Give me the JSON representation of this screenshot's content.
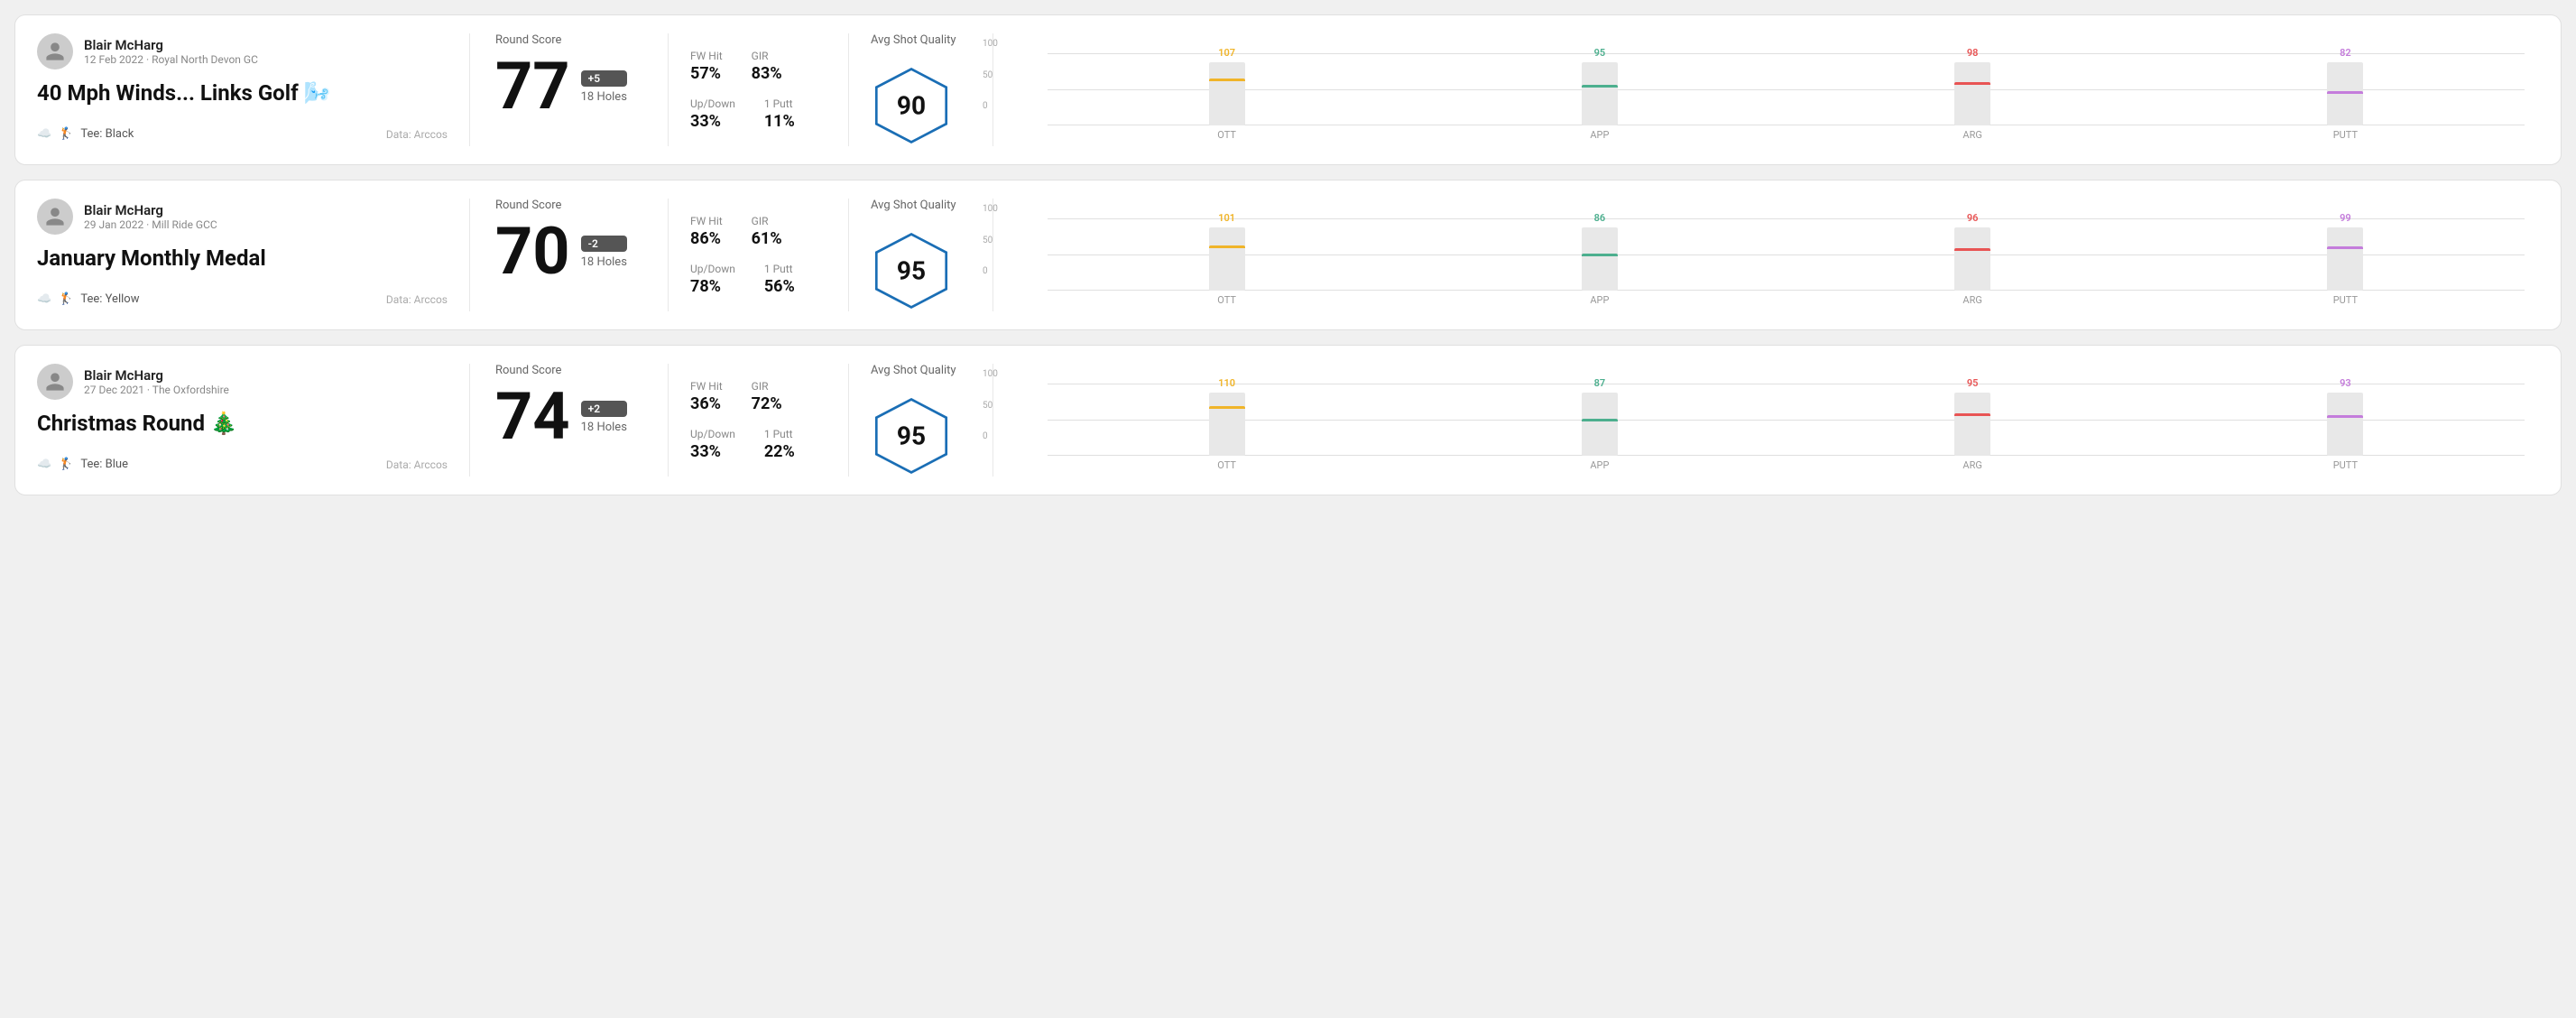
{
  "rounds": [
    {
      "id": "round1",
      "user_name": "Blair McHarg",
      "user_date": "12 Feb 2022 · Royal North Devon GC",
      "round_title": "40 Mph Winds... Links Golf 🌬️",
      "tee_color": "Black",
      "data_source": "Data: Arccos",
      "score": "77",
      "score_diff": "+5",
      "holes": "18 Holes",
      "fw_hit": "57%",
      "gir": "83%",
      "up_down": "33%",
      "one_putt": "11%",
      "avg_quality": "90",
      "chart": {
        "bars": [
          {
            "label": "OTT",
            "value": 107,
            "color": "#f0b429",
            "pct": 75
          },
          {
            "label": "APP",
            "value": 95,
            "color": "#4caf8e",
            "pct": 65
          },
          {
            "label": "ARG",
            "value": 98,
            "color": "#e85454",
            "pct": 68
          },
          {
            "label": "PUTT",
            "value": 82,
            "color": "#c47cdb",
            "pct": 55
          }
        ]
      }
    },
    {
      "id": "round2",
      "user_name": "Blair McHarg",
      "user_date": "29 Jan 2022 · Mill Ride GCC",
      "round_title": "January Monthly Medal",
      "tee_color": "Yellow",
      "data_source": "Data: Arccos",
      "score": "70",
      "score_diff": "-2",
      "holes": "18 Holes",
      "fw_hit": "86%",
      "gir": "61%",
      "up_down": "78%",
      "one_putt": "56%",
      "avg_quality": "95",
      "chart": {
        "bars": [
          {
            "label": "OTT",
            "value": 101,
            "color": "#f0b429",
            "pct": 72
          },
          {
            "label": "APP",
            "value": 86,
            "color": "#4caf8e",
            "pct": 58
          },
          {
            "label": "ARG",
            "value": 96,
            "color": "#e85454",
            "pct": 67
          },
          {
            "label": "PUTT",
            "value": 99,
            "color": "#c47cdb",
            "pct": 70
          }
        ]
      }
    },
    {
      "id": "round3",
      "user_name": "Blair McHarg",
      "user_date": "27 Dec 2021 · The Oxfordshire",
      "round_title": "Christmas Round 🎄",
      "tee_color": "Blue",
      "data_source": "Data: Arccos",
      "score": "74",
      "score_diff": "+2",
      "holes": "18 Holes",
      "fw_hit": "36%",
      "gir": "72%",
      "up_down": "33%",
      "one_putt": "22%",
      "avg_quality": "95",
      "chart": {
        "bars": [
          {
            "label": "OTT",
            "value": 110,
            "color": "#f0b429",
            "pct": 78
          },
          {
            "label": "APP",
            "value": 87,
            "color": "#4caf8e",
            "pct": 59
          },
          {
            "label": "ARG",
            "value": 95,
            "color": "#e85454",
            "pct": 67
          },
          {
            "label": "PUTT",
            "value": 93,
            "color": "#c47cdb",
            "pct": 65
          }
        ]
      }
    }
  ],
  "labels": {
    "round_score": "Round Score",
    "fw_hit": "FW Hit",
    "gir": "GIR",
    "up_down": "Up/Down",
    "one_putt": "1 Putt",
    "avg_quality": "Avg Shot Quality",
    "y_100": "100",
    "y_50": "50",
    "y_0": "0"
  }
}
